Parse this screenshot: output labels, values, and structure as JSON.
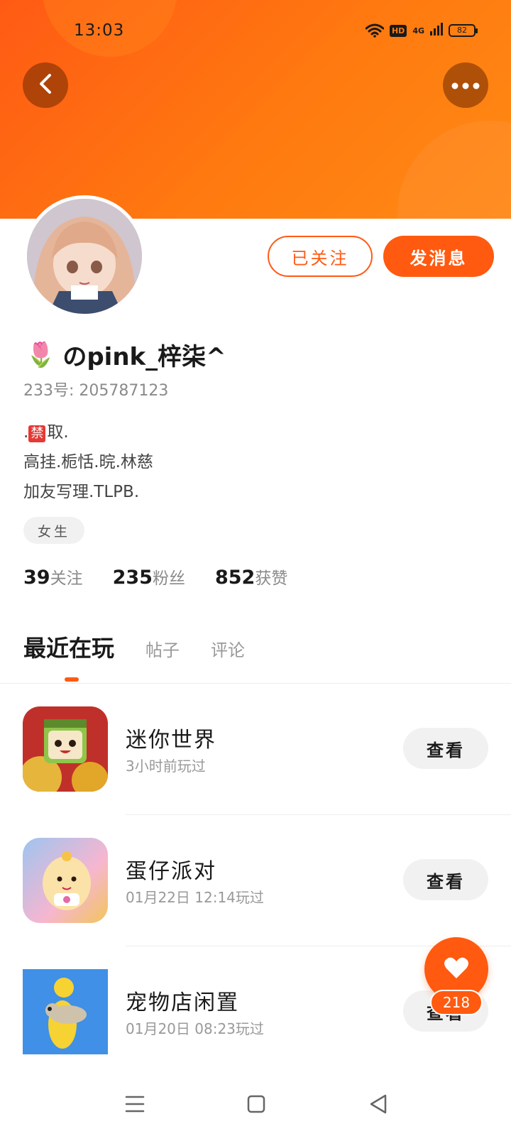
{
  "status_bar": {
    "time": "13:03",
    "hd_label": "HD",
    "signal_label": "4G",
    "battery": "82"
  },
  "header": {
    "back_icon": "chevron-left-icon",
    "more_icon": "more-horizontal-icon",
    "colors": {
      "start": "#ff5a14",
      "end": "#ff8a14"
    }
  },
  "profile": {
    "name_emoji": "🌷",
    "name": "のpink_梓柒^",
    "id_text": "233号: 205787123",
    "bio": {
      "line1_prefix": ".",
      "line1_badge": "禁",
      "line1_suffix": "取.",
      "line2": "高挂.栀恬.晥.林慈",
      "line3": "加友写理.TLPB."
    },
    "gender": "女生",
    "stats": [
      {
        "value": "39",
        "label": "关注"
      },
      {
        "value": "235",
        "label": "粉丝"
      },
      {
        "value": "852",
        "label": "获赞"
      }
    ]
  },
  "actions": {
    "follow_label": "已关注",
    "message_label": "发消息"
  },
  "tabs": [
    {
      "label": "最近在玩",
      "active": true
    },
    {
      "label": "帖子",
      "active": false
    },
    {
      "label": "评论",
      "active": false
    }
  ],
  "games": [
    {
      "name": "迷你世界",
      "time": "3小时前玩过",
      "button": "查看"
    },
    {
      "name": "蛋仔派对",
      "time": "01月22日 12:14玩过",
      "button": "查看"
    },
    {
      "name": "宠物店闲置",
      "time": "01月20日 08:23玩过",
      "button": "查看"
    }
  ],
  "like_fab": {
    "icon": "heart-icon",
    "count": "218"
  },
  "accent_color": "#ff5a0f"
}
